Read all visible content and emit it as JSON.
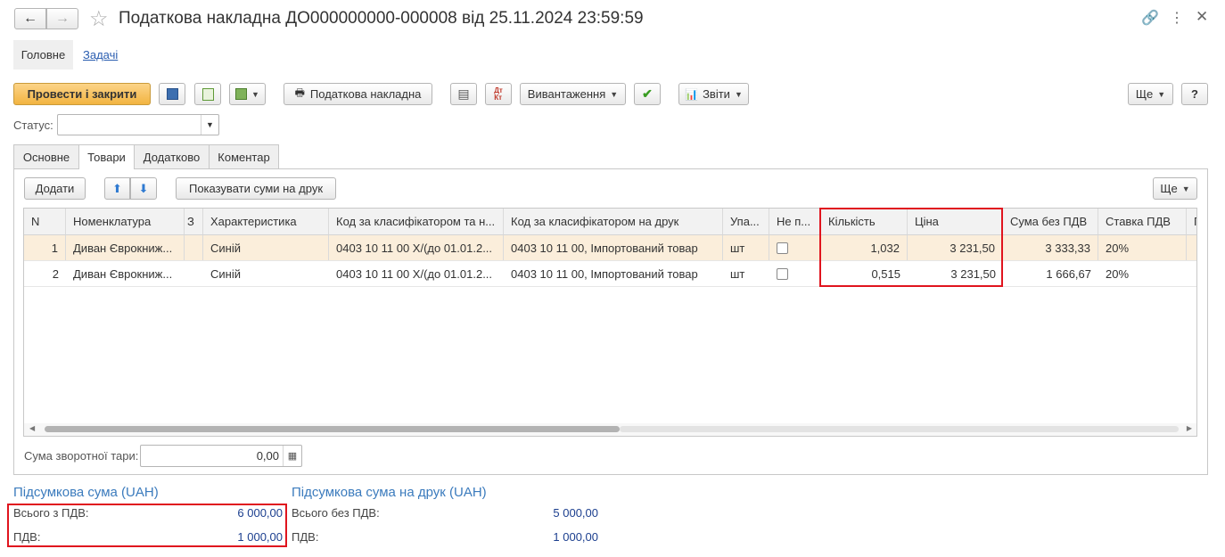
{
  "window": {
    "title": "Податкова накладна ДО000000000-000008 від 25.11.2024 23:59:59"
  },
  "nav_tabs": [
    "Головне",
    "Задачі"
  ],
  "toolbar": {
    "post_close": "Провести і закрити",
    "tax_invoice": "Податкова накладна",
    "export": "Вивантаження",
    "reports": "Звіти",
    "more": "Ще",
    "help": "?"
  },
  "status": {
    "label": "Статус:",
    "value": ""
  },
  "doc_tabs": [
    "Основне",
    "Товари",
    "Додатково",
    "Коментар"
  ],
  "table_toolbar": {
    "add": "Додати",
    "show_print_sums": "Показувати суми на друк",
    "more": "Ще"
  },
  "table": {
    "columns": [
      "N",
      "Номенклатура",
      "З",
      "Характеристика",
      "Код за класифікатором та н...",
      "Код за класифікатором на друк",
      "Упа...",
      "Не п...",
      "Кількість",
      "Ціна",
      "Сума без ПДВ",
      "Ставка ПДВ",
      "П"
    ],
    "rows": [
      {
        "n": "1",
        "item": "Диван Єврокниж...",
        "char": "Синій",
        "code": "0403 10 11 00 Х/(до 01.01.2...",
        "code_print": "0403 10 11 00, Імпортований товар",
        "unit": "шт",
        "qty": "1,032",
        "price": "3 231,50",
        "sum": "3 333,33",
        "vat": "20%"
      },
      {
        "n": "2",
        "item": "Диван Єврокниж...",
        "char": "Синій",
        "code": "0403 10 11 00 Х/(до 01.01.2...",
        "code_print": "0403 10 11 00, Імпортований товар",
        "unit": "шт",
        "qty": "0,515",
        "price": "3 231,50",
        "sum": "1 666,67",
        "vat": "20%"
      }
    ]
  },
  "return_tare": {
    "label": "Сума зворотної тари:",
    "value": "0,00"
  },
  "totals": {
    "title": "Підсумкова сума (UAH)",
    "total_label": "Всього з ПДВ:",
    "total_value": "6 000,00",
    "vat_label": "ПДВ:",
    "vat_value": "1 000,00"
  },
  "print_totals": {
    "title": "Підсумкова сума на друк (UAH)",
    "total_label": "Всього без ПДВ:",
    "total_value": "5 000,00",
    "vat_label": "ПДВ:",
    "vat_value": "1 000,00"
  },
  "colors": {
    "accent": "#f2b441",
    "highlight": "#e0141e",
    "link": "#3b7bbd",
    "selected_row": "#fbeedb"
  }
}
